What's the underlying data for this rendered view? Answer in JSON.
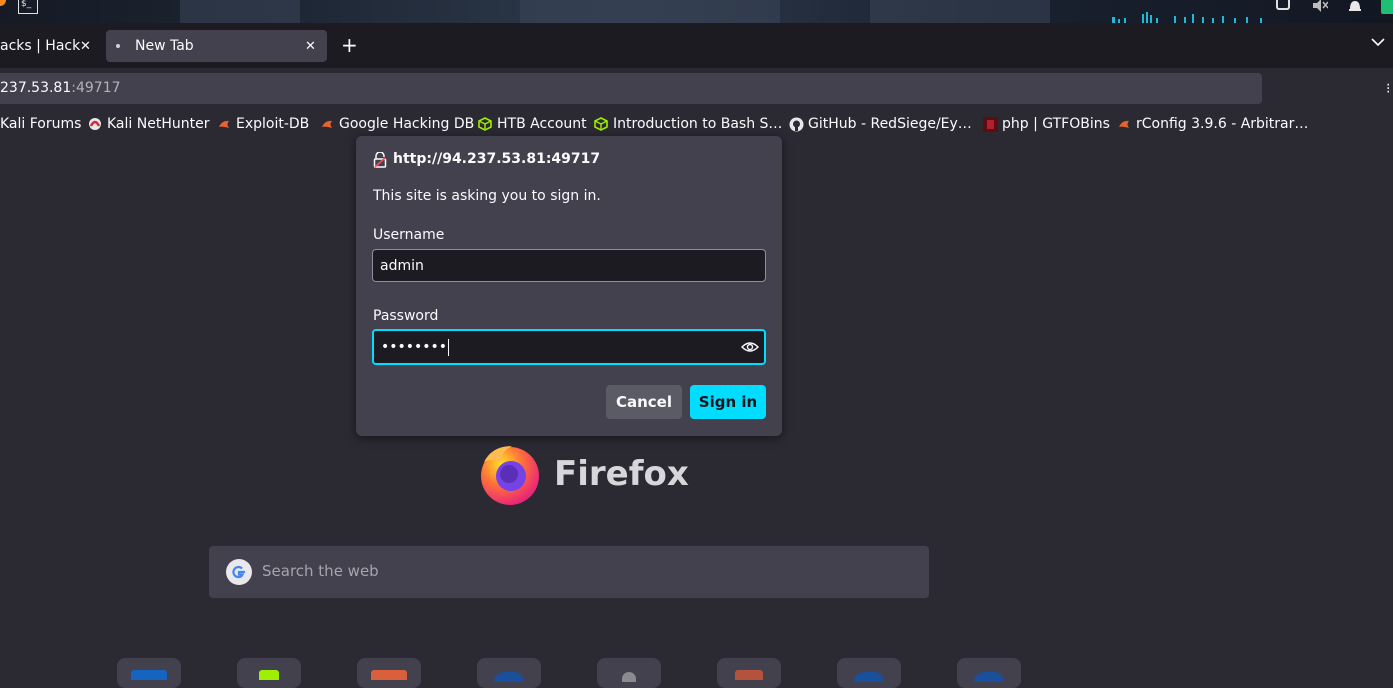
{
  "tabs": [
    {
      "label": "acks | Hack",
      "close": "✕"
    },
    {
      "label": "New Tab",
      "close": "✕"
    }
  ],
  "new_tab_symbol": "+",
  "tab_list_symbol": "⌄",
  "url": {
    "host": "237.53.81",
    "port": ":49717"
  },
  "bookmarks": [
    {
      "label": "Kali Forums",
      "icon": "kali-icon"
    },
    {
      "label": "Kali NetHunter",
      "icon": "nethunter-icon"
    },
    {
      "label": "Exploit-DB",
      "icon": "exploitdb-icon"
    },
    {
      "label": "Google Hacking DB",
      "icon": "exploitdb-icon"
    },
    {
      "label": "HTB Account",
      "icon": "htb-icon"
    },
    {
      "label": "Introduction to Bash S…",
      "icon": "htb-icon"
    },
    {
      "label": "GitHub - RedSiege/Ey…",
      "icon": "github-icon"
    },
    {
      "label": "php | GTFOBins",
      "icon": "gtfobins-icon"
    },
    {
      "label": "rConfig 3.9.6 - Arbitrar…",
      "icon": "exploitdb-icon"
    }
  ],
  "dialog": {
    "origin": "http://94.237.53.81:49717",
    "message": "This site is asking you to sign in.",
    "username_label": "Username",
    "username_value": "admin",
    "password_label": "Password",
    "password_value": "••••••••",
    "cancel_label": "Cancel",
    "signin_label": "Sign in"
  },
  "brand": "Firefox",
  "search_placeholder": "Search the web",
  "colors": {
    "accent": "#00ddff",
    "dialog_bg": "#42414d",
    "page_bg": "#2b2a33"
  }
}
